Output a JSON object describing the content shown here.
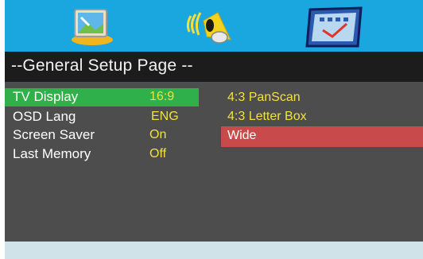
{
  "tabs": [
    {
      "icon": "general-setup-icon"
    },
    {
      "icon": "audio-setup-icon"
    },
    {
      "icon": "preference-setup-icon"
    }
  ],
  "page": {
    "title": "--General Setup Page --"
  },
  "settings": [
    {
      "label": "TV Display",
      "value": "16:9",
      "selected": true
    },
    {
      "label": "OSD Lang",
      "value": "ENG"
    },
    {
      "label": "Screen Saver",
      "value": "On"
    },
    {
      "label": "Last Memory",
      "value": "Off"
    }
  ],
  "options": [
    {
      "label": "4:3 PanScan"
    },
    {
      "label": "4:3 Letter Box"
    },
    {
      "label": "Wide",
      "active": true
    }
  ],
  "colors": {
    "header": "#1aa6df",
    "selected_row": "#2fb04a",
    "active_option": "#c94a4a",
    "value_text": "#f2e040"
  }
}
